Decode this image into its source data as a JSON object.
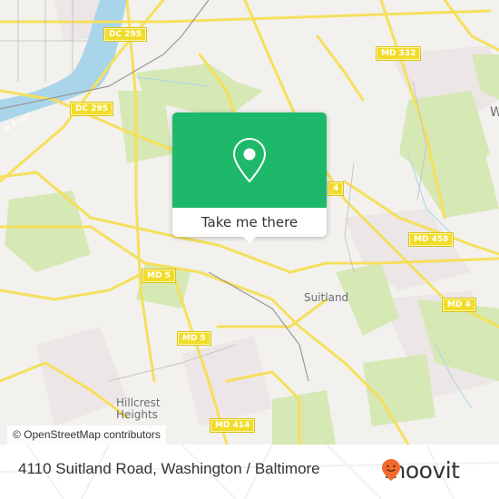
{
  "map": {
    "colors": {
      "land": "#f2f1ee",
      "park": "#d6e8b4",
      "water": "#a8d5ea",
      "road": "#f6df5c",
      "accent": "#1eb86a"
    },
    "road_shields": [
      {
        "id": "dc295-top",
        "label": "DC 295"
      },
      {
        "id": "dc295-bottom",
        "label": "DC 295"
      },
      {
        "id": "md332",
        "label": "MD 332"
      },
      {
        "id": "md4-partial",
        "label": "4"
      },
      {
        "id": "md458",
        "label": "MD 458"
      },
      {
        "id": "md4",
        "label": "MD 4"
      },
      {
        "id": "md5-top",
        "label": "MD 5"
      },
      {
        "id": "md5-bottom",
        "label": "MD 5"
      },
      {
        "id": "md414",
        "label": "MD 414"
      }
    ],
    "places": [
      {
        "id": "suitland",
        "label": "Suitland"
      },
      {
        "id": "hillcrest-heights",
        "label": "Hillcrest\nHeights"
      }
    ],
    "river_label": "ia River",
    "edge_label": "W",
    "attribution": "© OpenStreetMap contributors"
  },
  "popup": {
    "icon": "map-pin-icon",
    "button_label": "Take me there"
  },
  "footer": {
    "address": "4110 Suitland Road, Washington / Baltimore",
    "brand": "moovit",
    "brand_color": "#f26a2e"
  }
}
